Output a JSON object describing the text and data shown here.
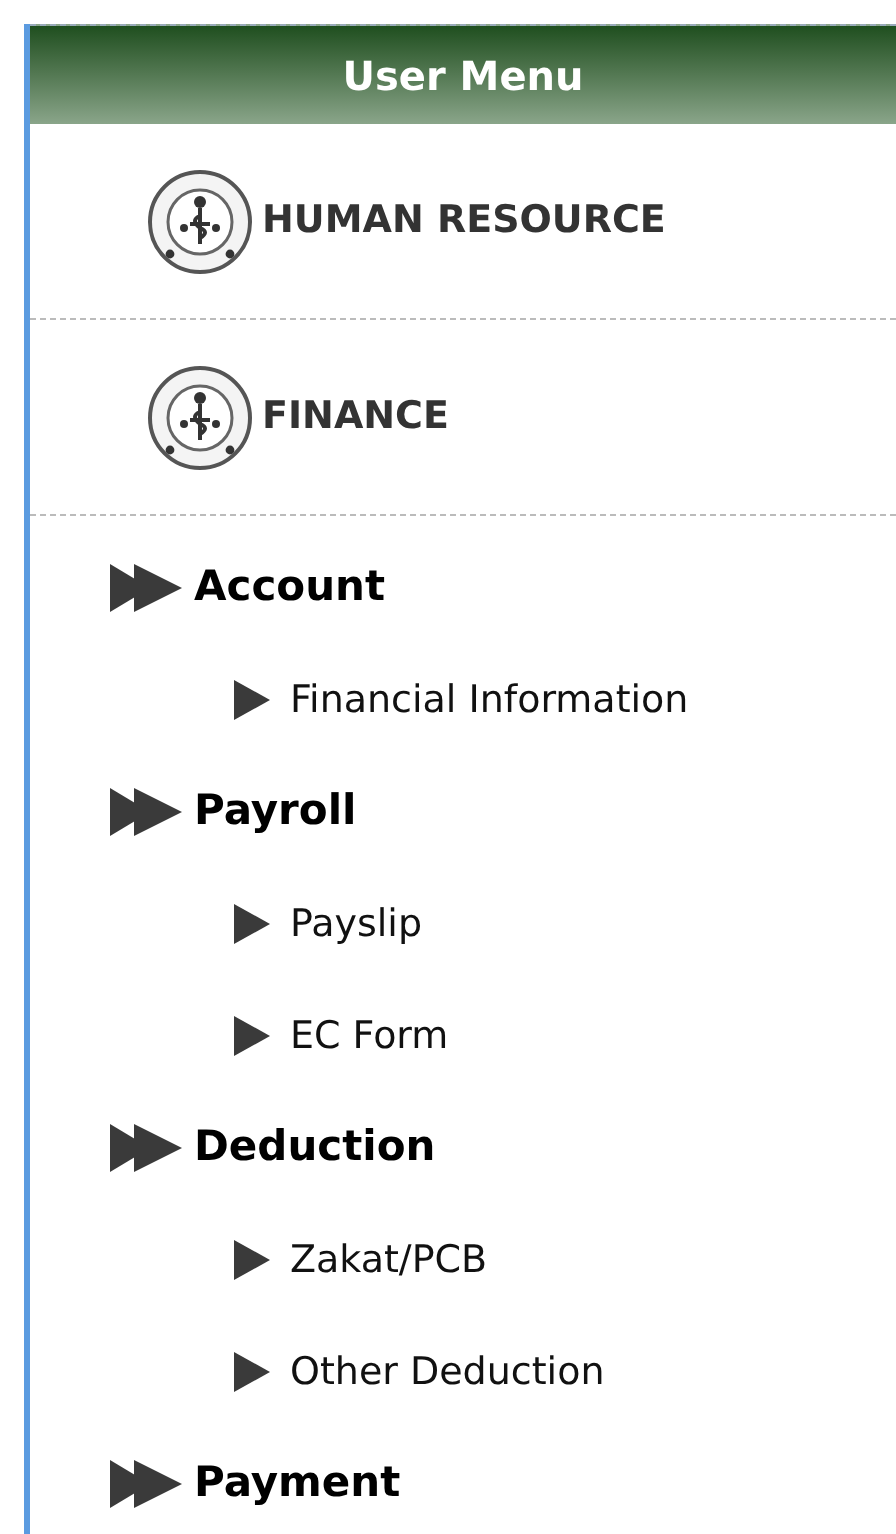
{
  "header": {
    "title": "User Menu"
  },
  "modules": [
    {
      "label": "HUMAN RESOURCE"
    },
    {
      "label": "FINANCE"
    }
  ],
  "sections": [
    {
      "label": "Account",
      "children": [
        {
          "label": "Financial Information"
        }
      ]
    },
    {
      "label": "Payroll",
      "children": [
        {
          "label": "Payslip"
        },
        {
          "label": "EC Form"
        }
      ]
    },
    {
      "label": "Deduction",
      "children": [
        {
          "label": "Zakat/PCB"
        },
        {
          "label": "Other Deduction"
        }
      ]
    },
    {
      "label": "Payment"
    }
  ]
}
